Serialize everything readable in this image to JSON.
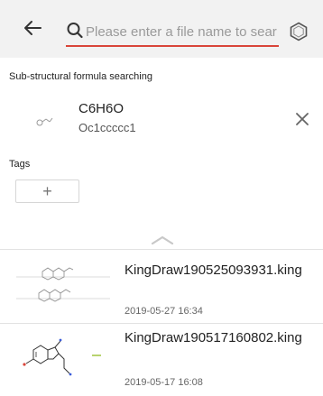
{
  "search": {
    "placeholder": "Please enter a file name to searc"
  },
  "substructure": {
    "title": "Sub-structural formula searching",
    "formula": "C6H6O",
    "smiles": "Oc1ccccc1"
  },
  "tags": {
    "label": "Tags",
    "add_symbol": "+"
  },
  "files": [
    {
      "name": "KingDraw190525093931.king",
      "date": "2019-05-27 16:34"
    },
    {
      "name": "KingDraw190517160802.king",
      "date": "2019-05-17 16:08"
    }
  ],
  "colors": {
    "accent": "#d9453a",
    "topbar_bg": "#f2f2f2"
  }
}
